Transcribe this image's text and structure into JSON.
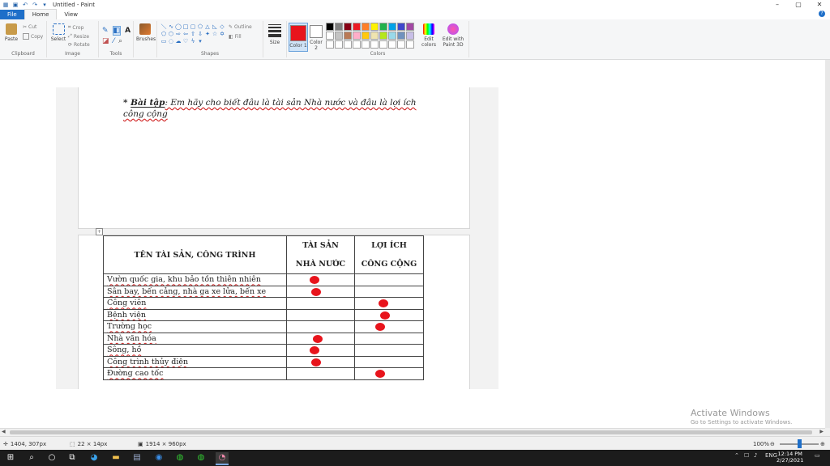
{
  "window": {
    "title": "Untitled - Paint",
    "controls": {
      "minimize": "–",
      "maximize": "▢",
      "close": "✕"
    }
  },
  "menu": {
    "file": "File",
    "home": "Home",
    "view": "View"
  },
  "ribbon": {
    "clipboard": {
      "paste": "Paste",
      "cut": "Cut",
      "copy": "Copy",
      "label": "Clipboard"
    },
    "image": {
      "select": "Select",
      "crop": "Crop",
      "resize": "Resize",
      "rotate": "Rotate",
      "label": "Image"
    },
    "tools": {
      "label": "Tools",
      "text_tool": "A"
    },
    "brushes": {
      "label": "Brushes"
    },
    "shapes": {
      "outline": "Outline",
      "fill": "Fill",
      "label": "Shapes"
    },
    "size": {
      "label": "Size"
    },
    "colors": {
      "color1": "Color 1",
      "color2": "Color 2",
      "edit_colors": "Edit colors",
      "edit_paint3d": "Edit with Paint 3D",
      "label": "Colors",
      "color1_value": "#e8141c",
      "color2_value": "#ffffff",
      "palette": [
        "#000000",
        "#7f7f7f",
        "#880015",
        "#ed1c24",
        "#ff7f27",
        "#fff200",
        "#22b14c",
        "#00a2e8",
        "#3f48cc",
        "#a349a4",
        "#ffffff",
        "#c3c3c3",
        "#b97a57",
        "#ffaec9",
        "#ffc90e",
        "#efe4b0",
        "#b5e61d",
        "#99d9ea",
        "#7092be",
        "#c8bfe7",
        "#ffffff",
        "#ffffff",
        "#ffffff",
        "#ffffff",
        "#ffffff",
        "#ffffff",
        "#ffffff",
        "#ffffff",
        "#ffffff",
        "#ffffff"
      ]
    }
  },
  "document": {
    "exercise_prefix": "* ",
    "exercise_label": "Bài tập",
    "exercise_text": ": Em hãy cho biết đâu là tài sản Nhà nước và đâu là lợi ích công cộng",
    "table": {
      "header_name": "TÊN TÀI SẢN, CÔNG TRÌNH",
      "header_state_1": "TÀI SẢN",
      "header_state_2": "NHÀ NƯỚC",
      "header_public_1": "LỢI ÍCH",
      "header_public_2": "CÔNG CỘNG",
      "rows": [
        {
          "name": "Vườn quốc gia, khu bảo tồn thiên nhiên",
          "mark": "state"
        },
        {
          "name": "Sân bay, bến cảng, nhà ga xe lửa, bến xe",
          "mark": "state"
        },
        {
          "name": "Công viên",
          "mark": "public"
        },
        {
          "name": "Bệnh viện",
          "mark": "public"
        },
        {
          "name": "Trường học",
          "mark": "public"
        },
        {
          "name": "Nhà văn hóa",
          "mark": "state"
        },
        {
          "name": "Sông, hồ",
          "mark": "state"
        },
        {
          "name": "Công trình thủy điện",
          "mark": "state"
        },
        {
          "name": "Đường cao tốc",
          "mark": "public"
        }
      ]
    }
  },
  "watermark": {
    "line1": "Activate Windows",
    "line2": "Go to Settings to activate Windows."
  },
  "status": {
    "cursor": "1404, 307px",
    "selection": "22 × 14px",
    "image_size": "1914 × 960px",
    "zoom": "100%"
  },
  "taskbar": {
    "language": "ENG",
    "time": "12:14 PM",
    "date": "2/27/2021"
  }
}
